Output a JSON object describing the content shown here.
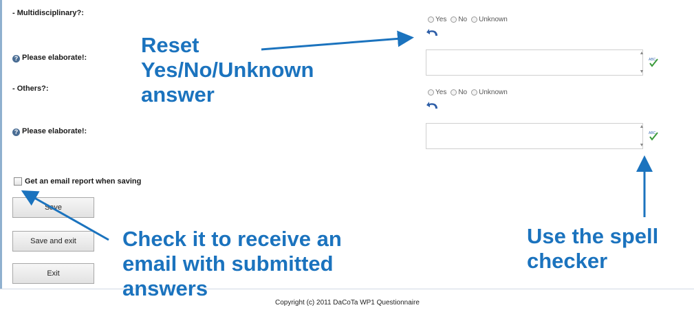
{
  "questions": [
    {
      "label": "- Multidisciplinary?:",
      "options": [
        "Yes",
        "No",
        "Unknown"
      ],
      "elaborate_label": "Please elaborate!:"
    },
    {
      "label": "- Others?:",
      "options": [
        "Yes",
        "No",
        "Unknown"
      ],
      "elaborate_label": "Please elaborate!:"
    }
  ],
  "email_report_label": "Get an email report when saving",
  "buttons": {
    "save": "Save",
    "save_exit": "Save and exit",
    "exit": "Exit"
  },
  "annotations": {
    "reset": [
      "Reset",
      "Yes/No/Unknown",
      "answer"
    ],
    "check": [
      "Check it to receive an",
      "email with submitted",
      "answers"
    ],
    "spell": [
      "Use the spell",
      "checker"
    ]
  },
  "footer": {
    "copyright": "Copyright (c) 2011 DaCoTa WP1 Questionnaire"
  },
  "colors": {
    "annotation": "#1b73be",
    "reset_icon": "#2f5fa8",
    "spell_check": "#3a9a3a"
  },
  "icons": {
    "reset": "undo-arrow-icon",
    "spell": "spell-check-icon",
    "help": "help-icon"
  }
}
